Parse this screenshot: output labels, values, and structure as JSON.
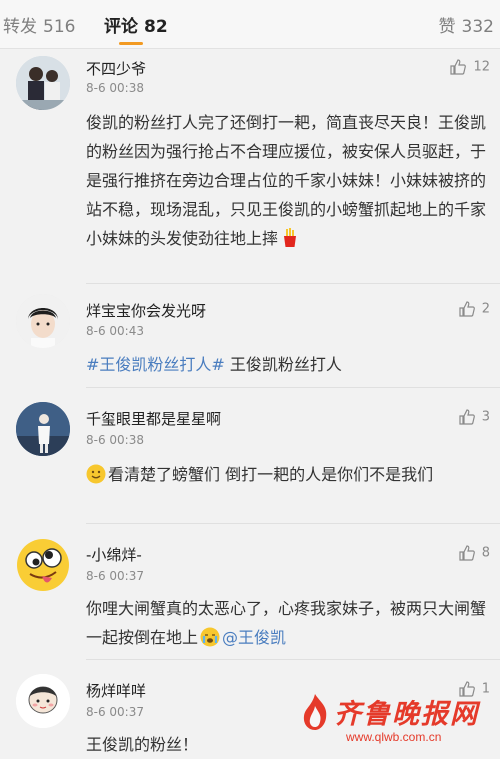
{
  "tabs": {
    "repost_label": "转发",
    "repost_count": "516",
    "comment_label": "评论",
    "comment_count": "82",
    "like_label": "赞",
    "like_count": "332"
  },
  "comments": [
    {
      "username": "不四少爷",
      "time": "8-6 00:38",
      "likes": "12",
      "text": "俊凯的粉丝打人完了还倒打一耙，简直丧尽天良！王俊凯的粉丝因为强行抢占不合理应援位，被安保人员驱赶，于是强行推挤在旁边合理占位的千家小妹妹！小妹妹被挤的站不稳，现场混乱，只见王俊凯的小螃蟹抓起地上的千家小妹妹的头发使劲往地上摔"
    },
    {
      "username": "烊宝宝你会发光呀",
      "time": "8-6 00:43",
      "likes": "2",
      "hashtag": "#王俊凯粉丝打人#",
      "text": " 王俊凯粉丝打人"
    },
    {
      "username": "千玺眼里都是星星啊",
      "time": "8-6 00:38",
      "likes": "3",
      "text": "看清楚了螃蟹们  倒打一耙的人是你们不是我们"
    },
    {
      "username": "-小绵烊-",
      "time": "8-6 00:37",
      "likes": "8",
      "text": "你哩大闸蟹真的太恶心了，心疼我家妹子，被两只大闸蟹一起按倒在地上",
      "mention": "@王俊凯"
    },
    {
      "username": "杨烊咩咩",
      "time": "8-6 00:37",
      "likes": "1",
      "text": "王俊凯的粉丝！"
    }
  ],
  "watermark": {
    "title": "齐鲁晚报网",
    "url": "www.qlwb.com.cn"
  },
  "colors": {
    "accent": "#f29a22",
    "link": "#4a7dbf",
    "watermark": "#e53a2a"
  }
}
